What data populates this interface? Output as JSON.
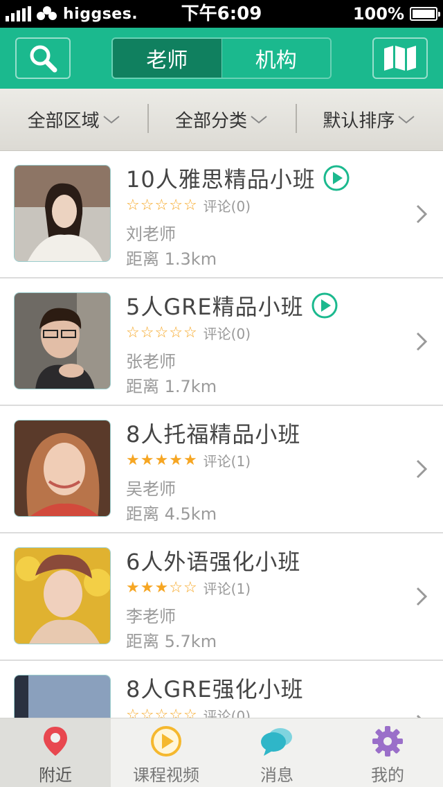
{
  "status_bar": {
    "carrier": "higgses.",
    "time": "下午6:09",
    "battery": "100%"
  },
  "header": {
    "tabs": [
      {
        "label": "老师",
        "active": true
      },
      {
        "label": "机构",
        "active": false
      }
    ],
    "search_icon": "search-icon",
    "map_icon": "map-icon"
  },
  "filters": [
    {
      "label": "全部区域"
    },
    {
      "label": "全部分类"
    },
    {
      "label": "默认排序"
    }
  ],
  "courses": [
    {
      "title": "10人雅思精品小班",
      "video": true,
      "rating": 0,
      "reviews": "评论(0)",
      "teacher": "刘老师",
      "distance": "距离 1.3km"
    },
    {
      "title": "5人GRE精品小班",
      "video": true,
      "rating": 0,
      "reviews": "评论(0)",
      "teacher": "张老师",
      "distance": "距离 1.7km"
    },
    {
      "title": "8人托福精品小班",
      "video": false,
      "rating": 5,
      "reviews": "评论(1)",
      "teacher": "吴老师",
      "distance": "距离 4.5km"
    },
    {
      "title": "6人外语强化小班",
      "video": false,
      "rating": 3,
      "reviews": "评论(1)",
      "teacher": "李老师",
      "distance": "距离 5.7km"
    },
    {
      "title": "8人GRE强化小班",
      "video": false,
      "rating": 0,
      "reviews": "评论(0)",
      "teacher": "",
      "distance": ""
    }
  ],
  "tabbar": [
    {
      "label": "附近",
      "icon": "location-pin-icon",
      "active": true,
      "color": "#e8474f"
    },
    {
      "label": "课程视频",
      "icon": "play-circle-icon",
      "active": false,
      "color": "#f5b82e"
    },
    {
      "label": "消息",
      "icon": "chat-bubbles-icon",
      "active": false,
      "color": "#2fb6c8"
    },
    {
      "label": "我的",
      "icon": "gear-icon",
      "active": false,
      "color": "#9a6fc9"
    }
  ],
  "colors": {
    "brand": "#1bb98e",
    "brand_dark": "#10805f",
    "star": "#f6a623"
  }
}
